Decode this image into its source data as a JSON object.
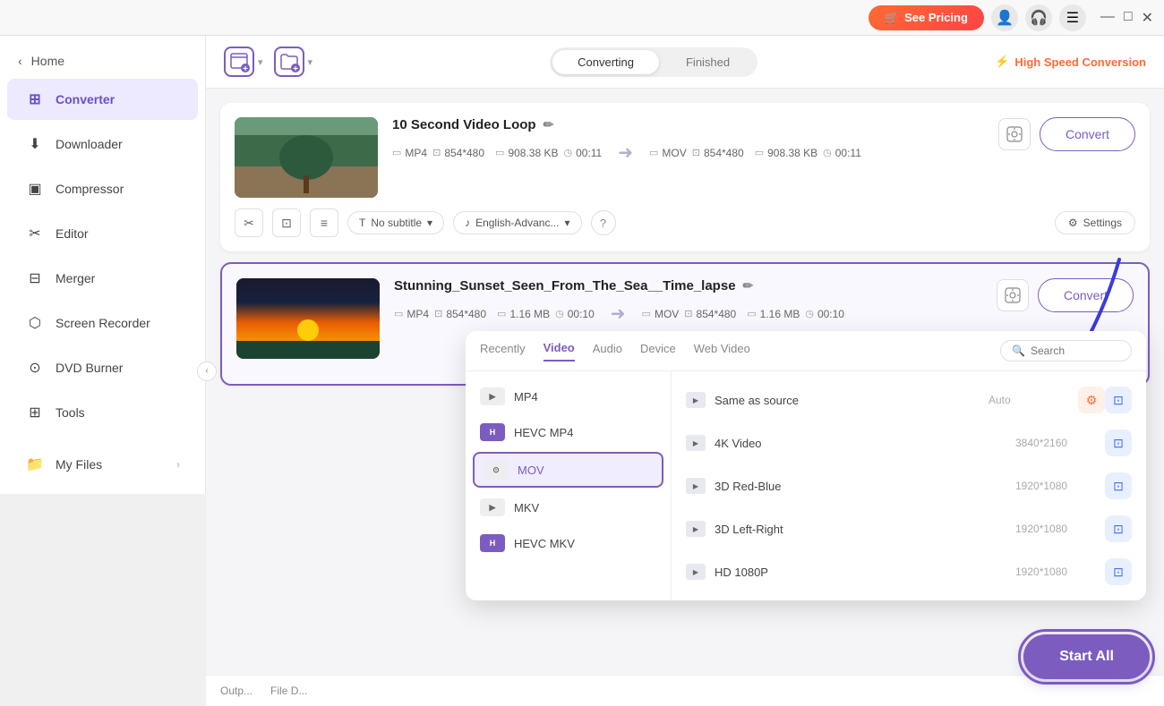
{
  "titlebar": {
    "see_pricing": "See Pricing",
    "controls": [
      "—",
      "□",
      "✕"
    ]
  },
  "sidebar": {
    "home_label": "Home",
    "items": [
      {
        "id": "converter",
        "label": "Converter",
        "active": true
      },
      {
        "id": "downloader",
        "label": "Downloader"
      },
      {
        "id": "compressor",
        "label": "Compressor"
      },
      {
        "id": "editor",
        "label": "Editor"
      },
      {
        "id": "merger",
        "label": "Merger"
      },
      {
        "id": "screen-recorder",
        "label": "Screen Recorder"
      },
      {
        "id": "dvd-burner",
        "label": "DVD Burner"
      },
      {
        "id": "tools",
        "label": "Tools"
      }
    ],
    "bottom_item": {
      "id": "my-files",
      "label": "My Files"
    }
  },
  "toolbar": {
    "add_file_label": "Add File",
    "add_folder_label": "Add Folder",
    "tabs": {
      "converting": "Converting",
      "finished": "Finished"
    },
    "active_tab": "converting",
    "high_speed": "High Speed Conversion"
  },
  "files": [
    {
      "id": "file1",
      "title": "10 Second Video Loop",
      "src_format": "MP4",
      "src_resolution": "854*480",
      "src_size": "908.38 KB",
      "src_duration": "00:11",
      "dst_format": "MOV",
      "dst_resolution": "854*480",
      "dst_size": "908.38 KB",
      "dst_duration": "00:11",
      "subtitle": "No subtitle",
      "language": "English-Advanc...",
      "convert_label": "Convert",
      "settings_label": "Settings"
    },
    {
      "id": "file2",
      "title": "Stunning_Sunset_Seen_From_The_Sea__Time_lapse",
      "src_format": "MP4",
      "src_resolution": "854*480",
      "src_size": "1.16 MB",
      "src_duration": "00:10",
      "dst_format": "MOV",
      "dst_resolution": "854*480",
      "dst_size": "1.16 MB",
      "dst_duration": "00:10",
      "convert_label": "Convert"
    }
  ],
  "format_dropdown": {
    "tabs": [
      "Recently",
      "Video",
      "Audio",
      "Device",
      "Web Video"
    ],
    "active_tab": "Video",
    "search_placeholder": "Search",
    "left_items": [
      {
        "id": "mp4",
        "label": "MP4",
        "type": "normal"
      },
      {
        "id": "hevc-mp4",
        "label": "HEVC MP4",
        "type": "hevc"
      },
      {
        "id": "mov",
        "label": "MOV",
        "type": "normal",
        "selected": true
      },
      {
        "id": "mkv",
        "label": "MKV",
        "type": "normal"
      },
      {
        "id": "hevc-mkv",
        "label": "HEVC MKV",
        "type": "hevc"
      }
    ],
    "right_items": [
      {
        "id": "same-as-source",
        "label": "Same as source",
        "resolution": "Auto",
        "action": "orange"
      },
      {
        "id": "4k-video",
        "label": "4K Video",
        "resolution": "3840*2160",
        "action": "blue"
      },
      {
        "id": "3d-red-blue",
        "label": "3D Red-Blue",
        "resolution": "1920*1080",
        "action": "blue"
      },
      {
        "id": "3d-left-right",
        "label": "3D Left-Right",
        "resolution": "1920*1080",
        "action": "blue"
      },
      {
        "id": "hd-1080p",
        "label": "HD 1080P",
        "resolution": "1920*1080",
        "action": "blue"
      }
    ]
  },
  "start_all_label": "Start All",
  "output_labels": [
    "Outp...",
    "File D..."
  ]
}
